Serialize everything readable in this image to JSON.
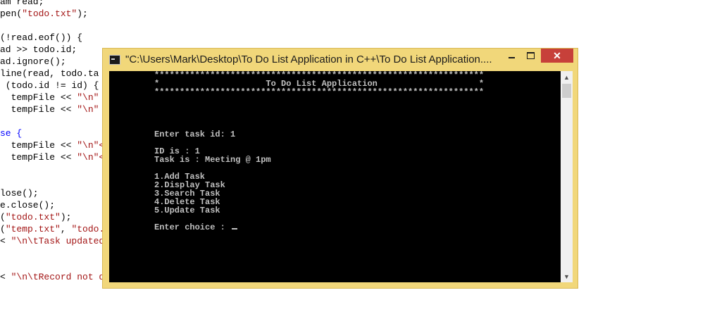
{
  "editor": {
    "lines": [
      [
        {
          "t": "am read;",
          "c": "o"
        }
      ],
      [
        {
          "t": "pen(",
          "c": "o"
        },
        {
          "t": "\"todo.txt\"",
          "c": "s"
        },
        {
          "t": ");",
          "c": "o"
        }
      ],
      [
        {
          "t": "",
          "c": "o"
        }
      ],
      [
        {
          "t": "(!read.eof()) {",
          "c": "o"
        }
      ],
      [
        {
          "t": "ad >> todo.id;",
          "c": "o"
        }
      ],
      [
        {
          "t": "ad.ignore();",
          "c": "o"
        }
      ],
      [
        {
          "t": "line(read, todo.ta",
          "c": "o"
        }
      ],
      [
        {
          "t": " (todo.id != id) {",
          "c": "o"
        }
      ],
      [
        {
          "t": "  tempFile << ",
          "c": "o"
        },
        {
          "t": "\"\\n\"",
          "c": "s"
        }
      ],
      [
        {
          "t": "  tempFile << ",
          "c": "o"
        },
        {
          "t": "\"\\n\"",
          "c": "s"
        }
      ],
      [
        {
          "t": "",
          "c": "o"
        }
      ],
      [
        {
          "t": "se {",
          "c": "k"
        }
      ],
      [
        {
          "t": "  tempFile << ",
          "c": "o"
        },
        {
          "t": "\"\\n\"<",
          "c": "s"
        }
      ],
      [
        {
          "t": "  tempFile << ",
          "c": "o"
        },
        {
          "t": "\"\\n\"<",
          "c": "s"
        }
      ],
      [
        {
          "t": "",
          "c": "o"
        }
      ],
      [
        {
          "t": "",
          "c": "o"
        }
      ],
      [
        {
          "t": "lose();",
          "c": "o"
        }
      ],
      [
        {
          "t": "e.close();",
          "c": "o"
        }
      ],
      [
        {
          "t": "(",
          "c": "o"
        },
        {
          "t": "\"todo.txt\"",
          "c": "s"
        },
        {
          "t": ");",
          "c": "o"
        }
      ],
      [
        {
          "t": "(",
          "c": "o"
        },
        {
          "t": "\"temp.txt\"",
          "c": "s"
        },
        {
          "t": ", ",
          "c": "o"
        },
        {
          "t": "\"todo.",
          "c": "s"
        }
      ],
      [
        {
          "t": "< ",
          "c": "o"
        },
        {
          "t": "\"\\n\\tTask updated",
          "c": "s"
        }
      ],
      [
        {
          "t": "",
          "c": "o"
        }
      ],
      [
        {
          "t": "",
          "c": "o"
        }
      ],
      [
        {
          "t": "< ",
          "c": "o"
        },
        {
          "t": "\"\\n\\tRecord not d",
          "c": "s"
        }
      ]
    ]
  },
  "window": {
    "title": "\"C:\\Users\\Mark\\Desktop\\To Do List Application in C++\\To Do List Application....",
    "min_label": "",
    "close_label": "✕"
  },
  "console": {
    "lines": [
      "*****************************************************************",
      "*                     To Do List Application                    *",
      "*****************************************************************",
      "",
      "",
      "",
      "",
      "Enter task id: 1",
      "",
      "ID is : 1",
      "Task is : Meeting @ 1pm",
      "",
      "1.Add Task",
      "2.Display Task",
      "3.Search Task",
      "4.Delete Task",
      "5.Update Task",
      "",
      "Enter choice : "
    ]
  },
  "scrollbar": {
    "up_arrow": "▲",
    "down_arrow": "▼"
  }
}
